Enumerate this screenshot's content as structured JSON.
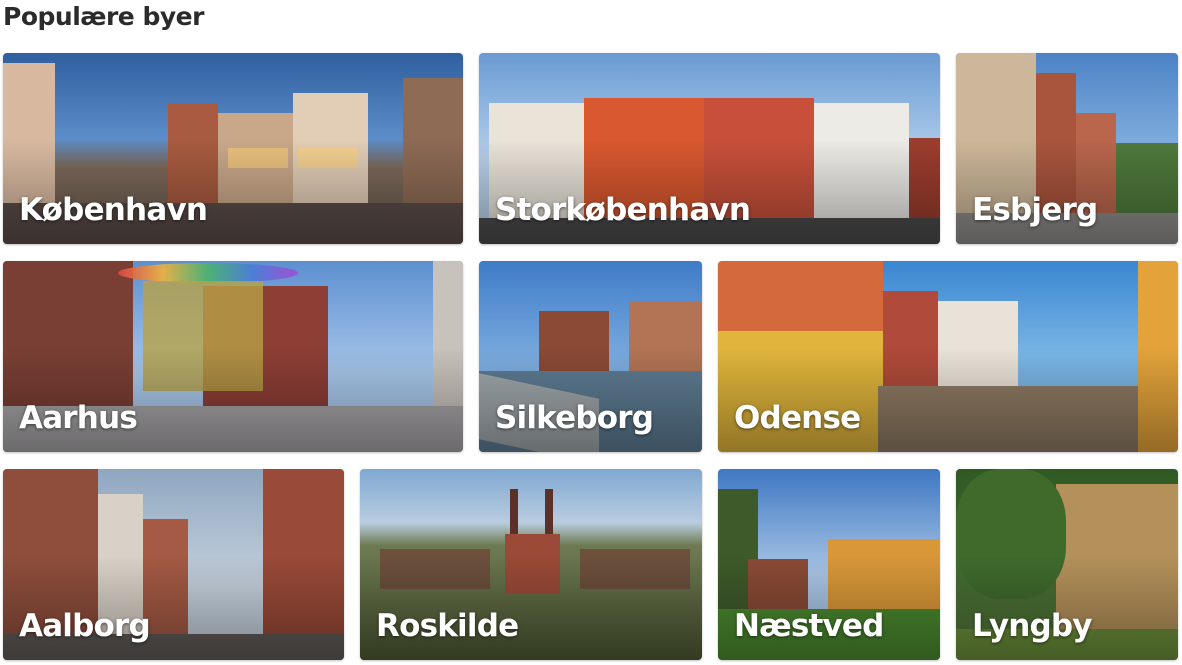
{
  "section": {
    "title": "Populære byer"
  },
  "cities": [
    {
      "name": "København"
    },
    {
      "name": "Storkøbenhavn"
    },
    {
      "name": "Esbjerg"
    },
    {
      "name": "Aarhus"
    },
    {
      "name": "Silkeborg"
    },
    {
      "name": "Odense"
    },
    {
      "name": "Aalborg"
    },
    {
      "name": "Roskilde"
    },
    {
      "name": "Næstved"
    },
    {
      "name": "Lyngby"
    }
  ]
}
